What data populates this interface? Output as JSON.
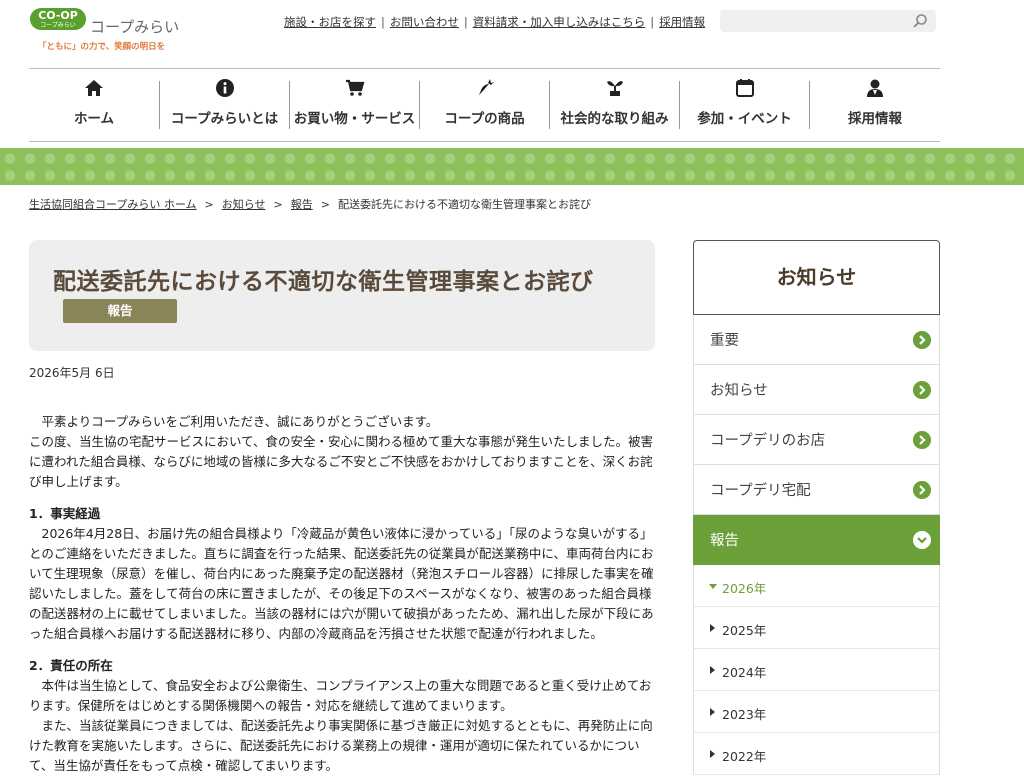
{
  "logo": {
    "badge": "CO-OP",
    "badge_sub": "コープみらい",
    "name": "コープみらい",
    "tagline": "「ともに」の力で、笑顔の明日を"
  },
  "utility_links": [
    "施設・お店を探す",
    "お問い合わせ",
    "資料請求・加入申し込みはこちら",
    "採用情報"
  ],
  "search": {
    "placeholder": "",
    "icon": "search-icon"
  },
  "nav": [
    {
      "label": "ホーム",
      "icon": "home-icon"
    },
    {
      "label": "コープみらいとは",
      "icon": "info-icon"
    },
    {
      "label": "お買い物・サービス",
      "icon": "cart-icon"
    },
    {
      "label": "コープの商品",
      "icon": "carrot-icon"
    },
    {
      "label": "社会的な取り組み",
      "icon": "sprout-icon"
    },
    {
      "label": "参加・イベント",
      "icon": "calendar-icon"
    },
    {
      "label": "採用情報",
      "icon": "person-icon"
    }
  ],
  "breadcrumb": [
    "生活協同組合コープみらい ホーム",
    "お知らせ",
    "報告",
    "配送委託先における不適切な衛生管理事案とお詫び"
  ],
  "article": {
    "title": "配送委託先における不適切な衛生管理事案とお詫び",
    "category": "報告",
    "date": "2026年5月 6日",
    "intro1": "平素よりコープみらいをご利用いただき、誠にありがとうございます。",
    "intro2": "この度、当生協の宅配サービスにおいて、食の安全・安心に関わる極めて重大な事態が発生いたしました。被害に遭われた組合員様、ならびに地域の皆様に多大なるご不安とご不快感をおかけしておりますことを、深くお詫び申し上げます。",
    "s1_title": "1．事実経過",
    "s1_body": "2026年4月28日、お届け先の組合員様より「冷蔵品が黄色い液体に浸かっている」「尿のような臭いがする」とのご連絡をいただきました。直ちに調査を行った結果、配送委託先の従業員が配送業務中に、車両荷台内において生理現象（尿意）を催し、荷台内にあった廃棄予定の配送器材（発泡スチロール容器）に排尿した事実を確認いたしました。蓋をして荷台の床に置きましたが、その後足下のスペースがなくなり、被害のあった組合員様の配送器材の上に載せてしまいました。当該の器材には穴が開いて破損があったため、漏れ出した尿が下段にあった組合員様へお届けする配送器材に移り、内部の冷蔵商品を汚損させた状態で配達が行われました。",
    "s2_title": "2．責任の所在",
    "s2_body1": "本件は当生協として、食品安全および公衆衛生、コンプライアンス上の重大な問題であると重く受け止めております。保健所をはじめとする関係機関への報告・対応を継続して進めてまいります。",
    "s2_body2": "また、当該従業員につきましては、配送委託先より事実関係に基づき厳正に対処するとともに、再発防止に向けた教育を実施いたします。さらに、配送委託先における業務上の規律・運用が適切に保たれているかについて、当生協が責任をもって点検・確認してまいります。"
  },
  "sidebar": {
    "title": "お知らせ",
    "items": [
      "重要",
      "お知らせ",
      "コープデリのお店",
      "コープデリ宅配",
      "報告"
    ],
    "active_item": "報告",
    "years": [
      "2026年",
      "2025年",
      "2024年",
      "2023年",
      "2022年"
    ],
    "current_year": "2026年"
  },
  "colors": {
    "brand_green": "#6aa037",
    "band_green": "#8dbf5a",
    "category_badge": "#8a8558",
    "title_text": "#5a4a3a"
  }
}
